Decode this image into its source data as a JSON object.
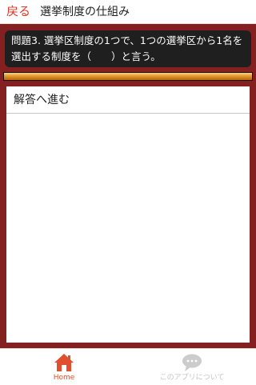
{
  "header": {
    "back_label": "戻る",
    "title": "選挙制度の仕組み"
  },
  "question": {
    "text": "問題3. 選挙区制度の1つで、1つの選挙区から1名を選出する制度を（　　）と言う。"
  },
  "progress": {
    "fraction": 1.0
  },
  "answer": {
    "proceed_label": "解答へ進む"
  },
  "tabs": [
    {
      "label": "Home",
      "icon": "home-icon",
      "active": true,
      "color": "#e0502e"
    },
    {
      "label": "このアプリについて",
      "icon": "speech-bubble-icon",
      "active": false,
      "color": "#c4c4c4"
    }
  ],
  "colors": {
    "accent": "#d93a2b",
    "frame": "#84201f",
    "question_bg": "#1f1f1f",
    "progress": "#e3982a"
  }
}
